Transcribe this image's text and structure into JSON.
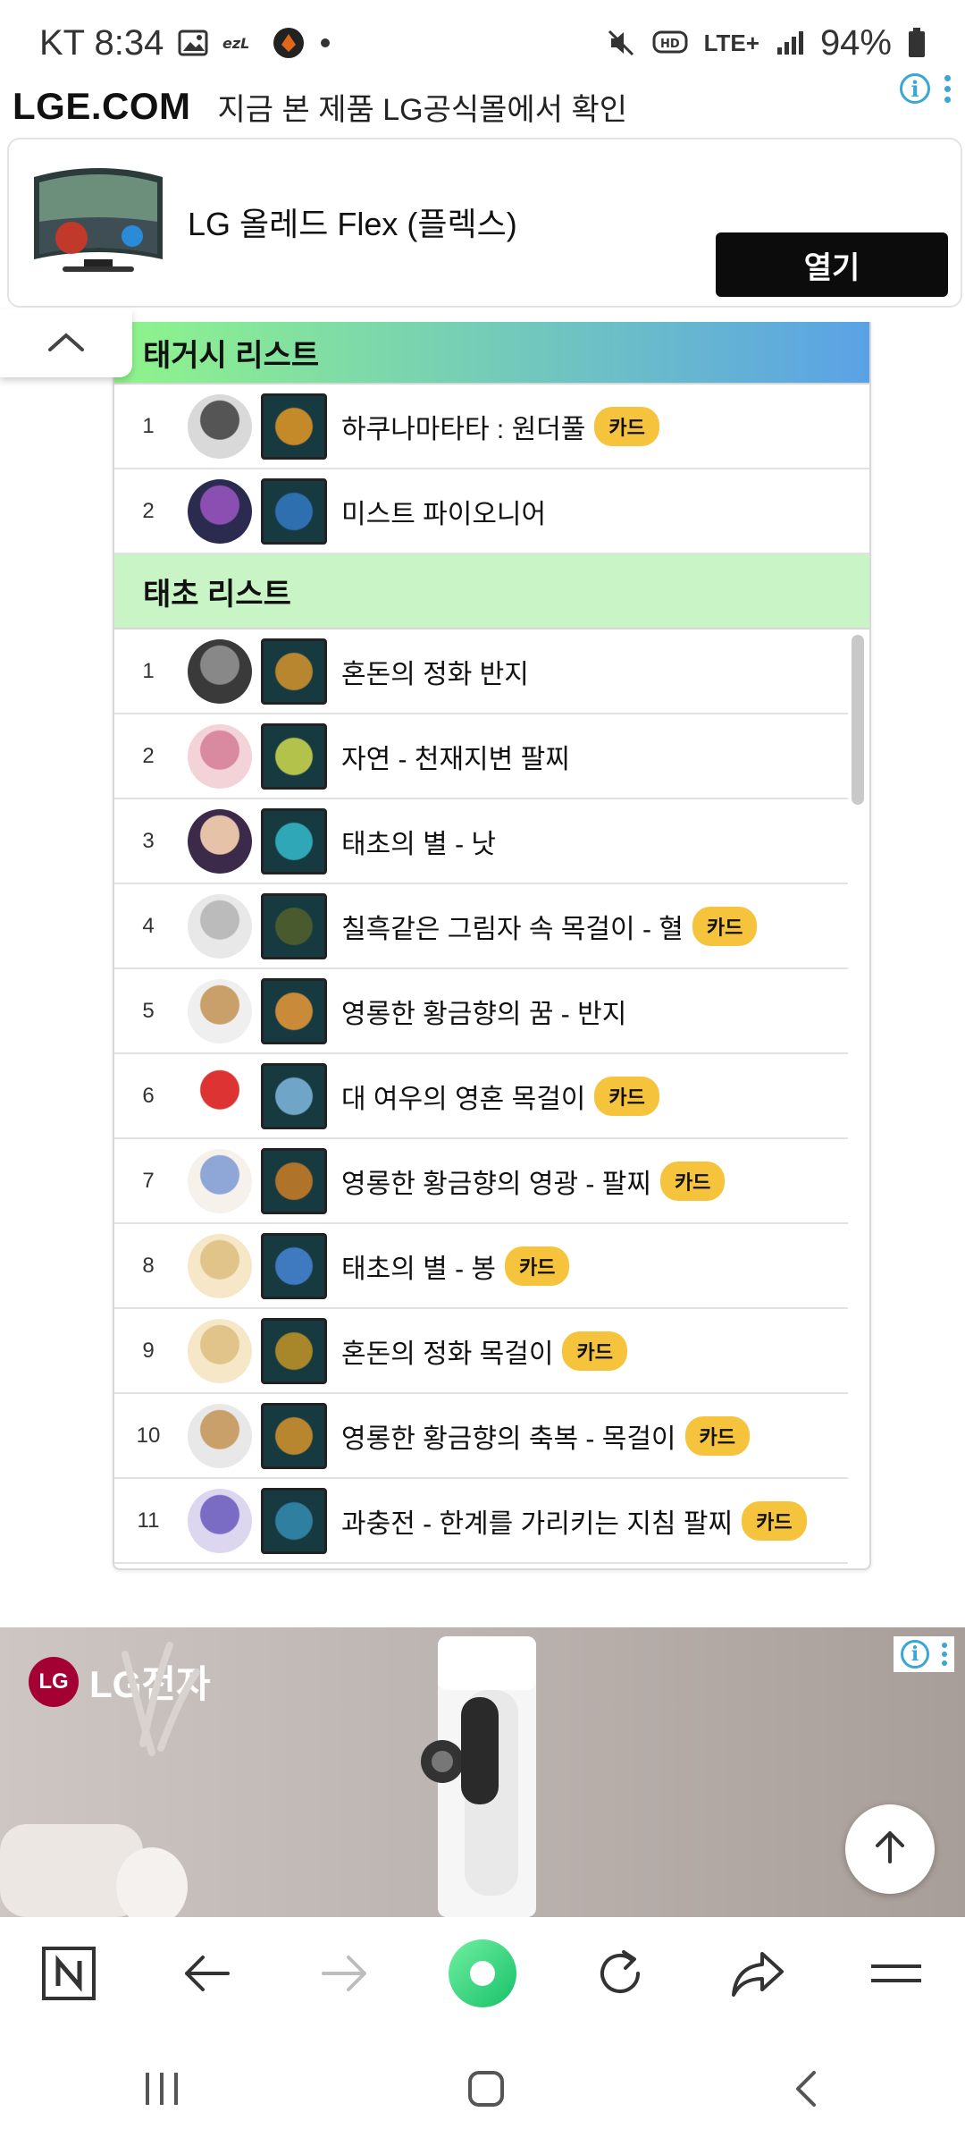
{
  "status_bar": {
    "carrier_time": "KT 8:34",
    "network": "LTE+",
    "battery": "94%"
  },
  "top_ad": {
    "brand": "LGE.COM",
    "tagline": "지금 본 제품 LG공식몰에서 확인",
    "product": "LG 올레드 Flex (플렉스)",
    "button": "열기"
  },
  "section1": {
    "title": "태거시 리스트",
    "rows": [
      {
        "rank": "1",
        "name": "하쿠나마타타 : 원더풀",
        "badge": "카드"
      },
      {
        "rank": "2",
        "name": "미스트 파이오니어",
        "badge": ""
      }
    ]
  },
  "section2": {
    "title": "태초 리스트",
    "rows": [
      {
        "rank": "1",
        "name": "혼돈의 정화 반지",
        "badge": ""
      },
      {
        "rank": "2",
        "name": "자연 - 천재지변 팔찌",
        "badge": ""
      },
      {
        "rank": "3",
        "name": "태초의 별 - 낫",
        "badge": ""
      },
      {
        "rank": "4",
        "name": "칠흑같은 그림자 속 목걸이 - 혈",
        "badge": "카드"
      },
      {
        "rank": "5",
        "name": "영롱한 황금향의 꿈 - 반지",
        "badge": ""
      },
      {
        "rank": "6",
        "name": "대 여우의 영혼 목걸이",
        "badge": "카드"
      },
      {
        "rank": "7",
        "name": "영롱한 황금향의 영광 - 팔찌",
        "badge": "카드"
      },
      {
        "rank": "8",
        "name": "태초의 별 - 봉",
        "badge": "카드"
      },
      {
        "rank": "9",
        "name": "혼돈의 정화 목걸이",
        "badge": "카드"
      },
      {
        "rank": "10",
        "name": "영롱한 황금향의 축복 - 목걸이",
        "badge": "카드"
      },
      {
        "rank": "11",
        "name": "과충전 - 한계를 가리키는 지침 팔찌",
        "badge": "카드"
      }
    ]
  },
  "bottom_ad": {
    "brand_mark": "LG",
    "brand": "LG전자"
  },
  "colors": {
    "badge": "#f6c33d",
    "section2_head": "#c9f4c5",
    "ad_info": "#3aa6d6",
    "lg_red": "#a50034"
  }
}
